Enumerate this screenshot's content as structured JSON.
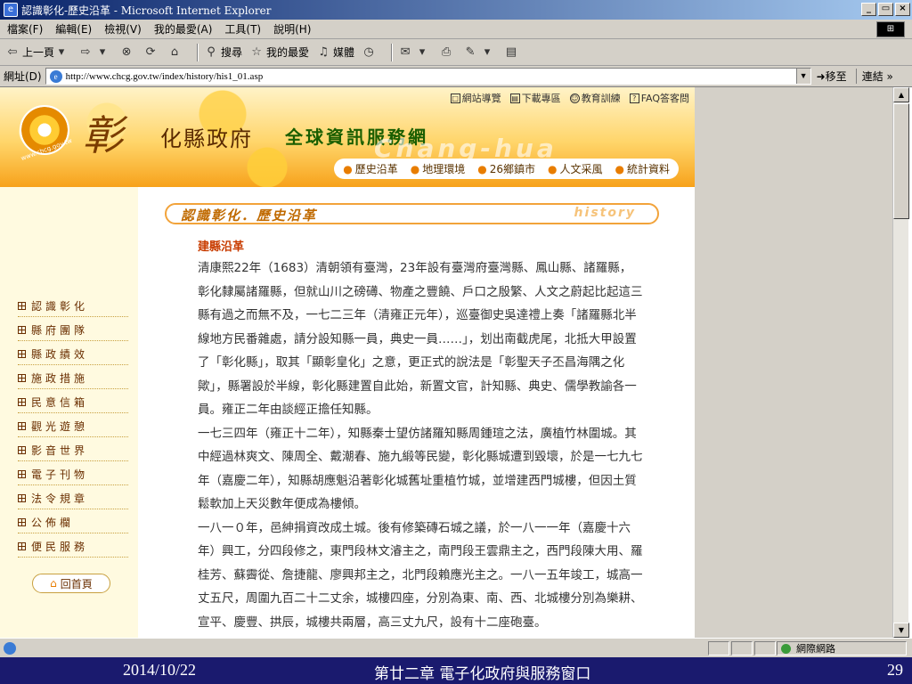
{
  "window": {
    "title": "認識彰化-歷史沿革 - Microsoft Internet Explorer",
    "controls": [
      "_",
      "▭",
      "×"
    ]
  },
  "menu": [
    "檔案(F)",
    "編輯(E)",
    "檢視(V)",
    "我的最愛(A)",
    "工具(T)",
    "說明(H)"
  ],
  "toolbar": {
    "back": "上一頁",
    "search": "搜尋",
    "favorites": "我的最愛",
    "media": "媒體"
  },
  "address": {
    "label": "網址(D)",
    "url": "http://www.chcg.gov.tw/index/history/his1_01.asp",
    "go": "移至",
    "links": "連結 »"
  },
  "site": {
    "logo_url": "www.chcg.gov.tw",
    "county_char": "彰",
    "county_rest": "化縣政府",
    "service_title": "全球資訊服務網",
    "watermark": "Chang-hua",
    "top_links": [
      "網站導覽",
      "下載專區",
      "教育訓練",
      "FAQ答客問"
    ],
    "nav": [
      "歷史沿革",
      "地理環境",
      "26鄉鎮市",
      "人文采風",
      "統計資料"
    ],
    "sidebar": [
      "認識彰化",
      "縣府團隊",
      "縣政績效",
      "施政措施",
      "民意信箱",
      "觀光遊憩",
      "影音世界",
      "電子刊物",
      "法令規章",
      "公佈欄",
      "便民服務"
    ],
    "home": "回首頁"
  },
  "article": {
    "heading": "認識彰化．歷史沿革",
    "heading_en": "history",
    "section_title": "建縣沿革",
    "paragraphs": [
      "清康熙22年（1683）清朝領有臺灣，23年設有臺灣府臺灣縣、鳳山縣、諸羅縣，彰化隸屬諸羅縣，但就山川之磅礡、物產之豐饒、戶口之殷繁、人文之蔚起比起這三縣有過之而無不及，一七二三年（清雍正元年），巡臺御史吳達禮上奏「諸羅縣北半線地方民番雜處，請分設知縣一員，典史一員……」，划出南截虎尾，北抵大甲設置了「彰化縣」，取其「顯彰皇化」之意，更正式的說法是「彰聖天子丕昌海隅之化歟」，縣署設於半線，彰化縣建置自此始，新置文官，計知縣、典史、儒學教諭各一員。雍正二年由談經正擔任知縣。",
      "一七三四年（雍正十二年），知縣秦士望仿諸羅知縣周鍾瑄之法，廣植竹林圍城。其中經過林爽文、陳周全、戴潮春、施九緞等民變，彰化縣城遭到毀壞，於是一七九七年（嘉慶二年），知縣胡應魁沿著彰化城舊址重植竹城，並增建西門城樓，但因土質鬆軟加上天災數年便成為樓傾。",
      "一八一０年，邑紳捐資改成土城。後有修築磚石城之議，於一八一一年（嘉慶十六年）興工，分四段修之，東門段林文濬主之，南門段王雲鼎主之，西門段陳大用、羅桂芳、蘇霽從、詹捷龍、廖興邦主之，北門段賴應光主之。一八一五年竣工，城高一丈五尺，周圍九百二十二丈余，城樓四座，分別為東、南、西、北城樓分別為樂耕、宣平、慶豐、拱辰，城樓共兩層，高三丈九尺，設有十二座砲臺。"
    ]
  },
  "status": {
    "zone": "網際網路"
  },
  "footer": {
    "date": "2014/10/22",
    "chapter": "第廿二章 電子化政府與服務窗口",
    "page": "29"
  }
}
